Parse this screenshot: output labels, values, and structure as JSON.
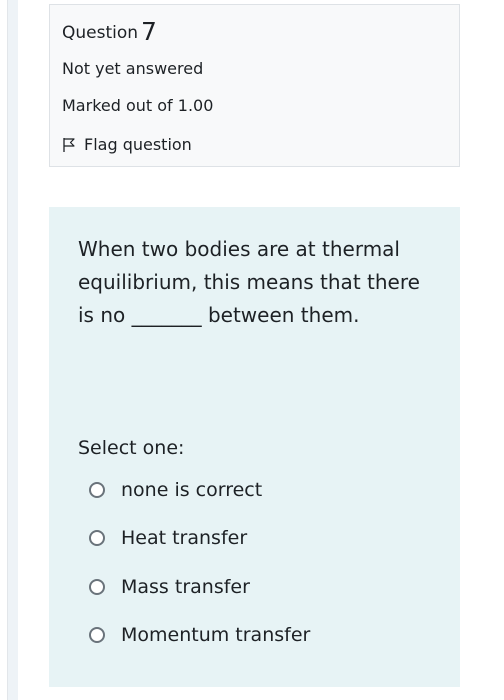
{
  "info": {
    "question_label": "Question",
    "question_number": "7",
    "state": "Not yet answered",
    "grade": "Marked out of 1.00",
    "flag_label": "Flag question",
    "flag_icon": "flag-icon"
  },
  "question": {
    "text": "When two bodies are at thermal equilibrium, this means that there is no _______ between them.",
    "prompt": "Select one:",
    "options": [
      {
        "label": "none is correct"
      },
      {
        "label": "Heat transfer"
      },
      {
        "label": "Mass transfer"
      },
      {
        "label": "Momentum transfer"
      }
    ]
  },
  "colors": {
    "formulation_bg": "#e7f3f5",
    "info_bg": "#f8f9fa"
  }
}
